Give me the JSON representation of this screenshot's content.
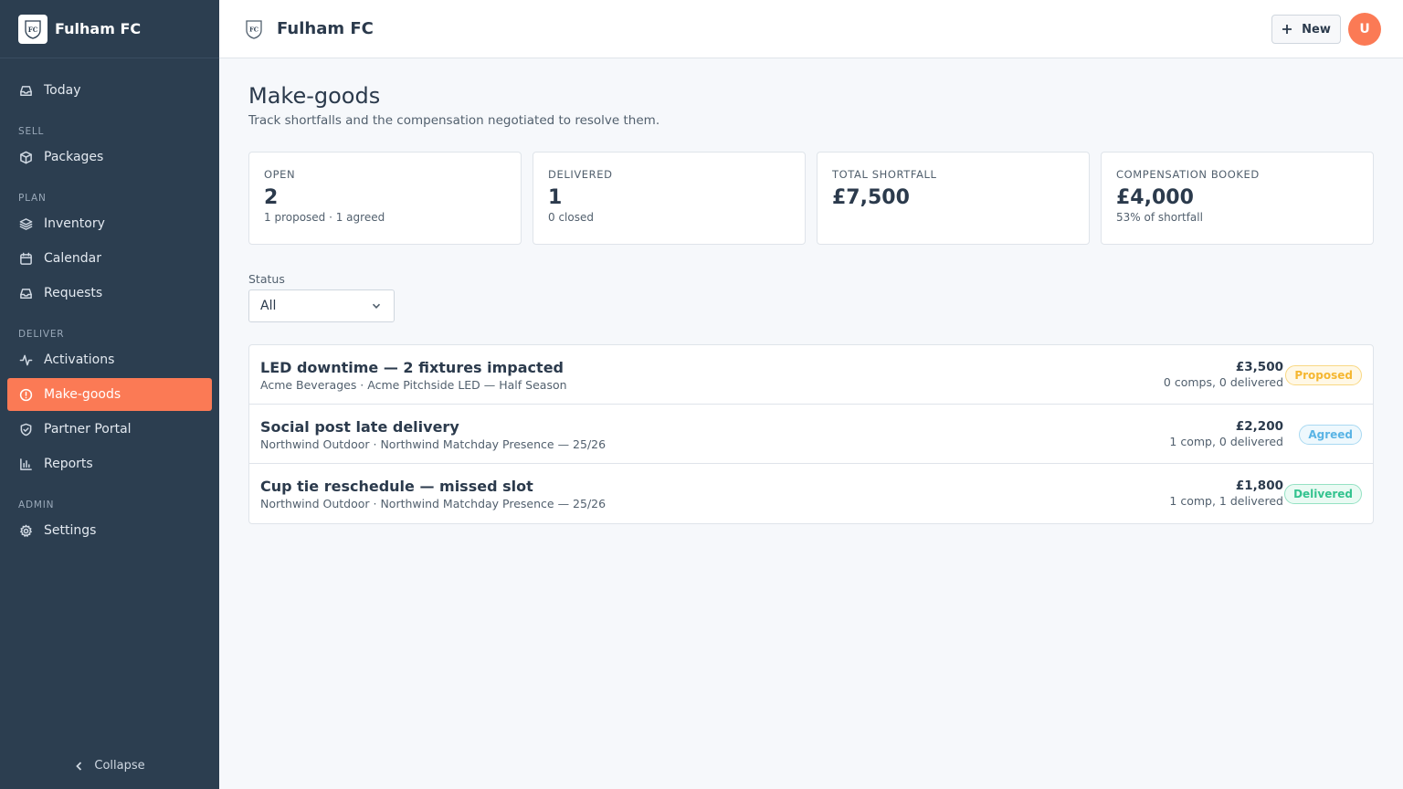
{
  "app": {
    "brand_name": "Fulham FC",
    "logo_text": "FC"
  },
  "sidebar": {
    "items": [
      {
        "label": "Today",
        "icon": "inbox-icon"
      },
      {
        "section": "SELL"
      },
      {
        "label": "Packages",
        "icon": "package-icon"
      },
      {
        "section": "PLAN"
      },
      {
        "label": "Inventory",
        "icon": "layers-icon"
      },
      {
        "label": "Calendar",
        "icon": "calendar-icon"
      },
      {
        "label": "Requests",
        "icon": "inbox-icon"
      },
      {
        "section": "DELIVER"
      },
      {
        "label": "Activations",
        "icon": "activity-icon"
      },
      {
        "label": "Make-goods",
        "icon": "alert-circle-icon",
        "active": true
      },
      {
        "label": "Partner Portal",
        "icon": "shield-check-icon"
      },
      {
        "label": "Reports",
        "icon": "bar-chart-icon"
      },
      {
        "section": "ADMIN"
      },
      {
        "label": "Settings",
        "icon": "gear-icon"
      }
    ],
    "collapse_label": "Collapse"
  },
  "header": {
    "title": "Fulham FC",
    "new_label": "New",
    "avatar_initial": "U"
  },
  "page": {
    "title": "Make-goods",
    "subtitle": "Track shortfalls and the compensation negotiated to resolve them."
  },
  "stats": [
    {
      "label": "OPEN",
      "value": "2",
      "sub": "1 proposed · 1 agreed"
    },
    {
      "label": "DELIVERED",
      "value": "1",
      "sub": "0 closed"
    },
    {
      "label": "TOTAL SHORTFALL",
      "value": "£7,500",
      "sub": ""
    },
    {
      "label": "COMPENSATION BOOKED",
      "value": "£4,000",
      "sub": "53% of shortfall"
    }
  ],
  "filter": {
    "label": "Status",
    "value": "All"
  },
  "makegoods": [
    {
      "title": "LED downtime — 2 fixtures impacted",
      "subtitle": "Acme Beverages · Acme Pitchside LED — Half Season",
      "amount": "£3,500",
      "meta": "0 comps, 0 delivered",
      "status": "Proposed",
      "status_class": "proposed"
    },
    {
      "title": "Social post late delivery",
      "subtitle": "Northwind Outdoor · Northwind Matchday Presence — 25/26",
      "amount": "£2,200",
      "meta": "1 comp, 0 delivered",
      "status": "Agreed",
      "status_class": "agreed"
    },
    {
      "title": "Cup tie reschedule — missed slot",
      "subtitle": "Northwind Outdoor · Northwind Matchday Presence — 25/26",
      "amount": "£1,800",
      "meta": "1 comp, 1 delivered",
      "status": "Delivered",
      "status_class": "delivered"
    }
  ],
  "colors": {
    "sidebar_bg": "#2c3e50",
    "accent": "#fb7a55",
    "proposed": "#f5b731",
    "agreed": "#5ab4e5",
    "delivered": "#34c38f"
  }
}
